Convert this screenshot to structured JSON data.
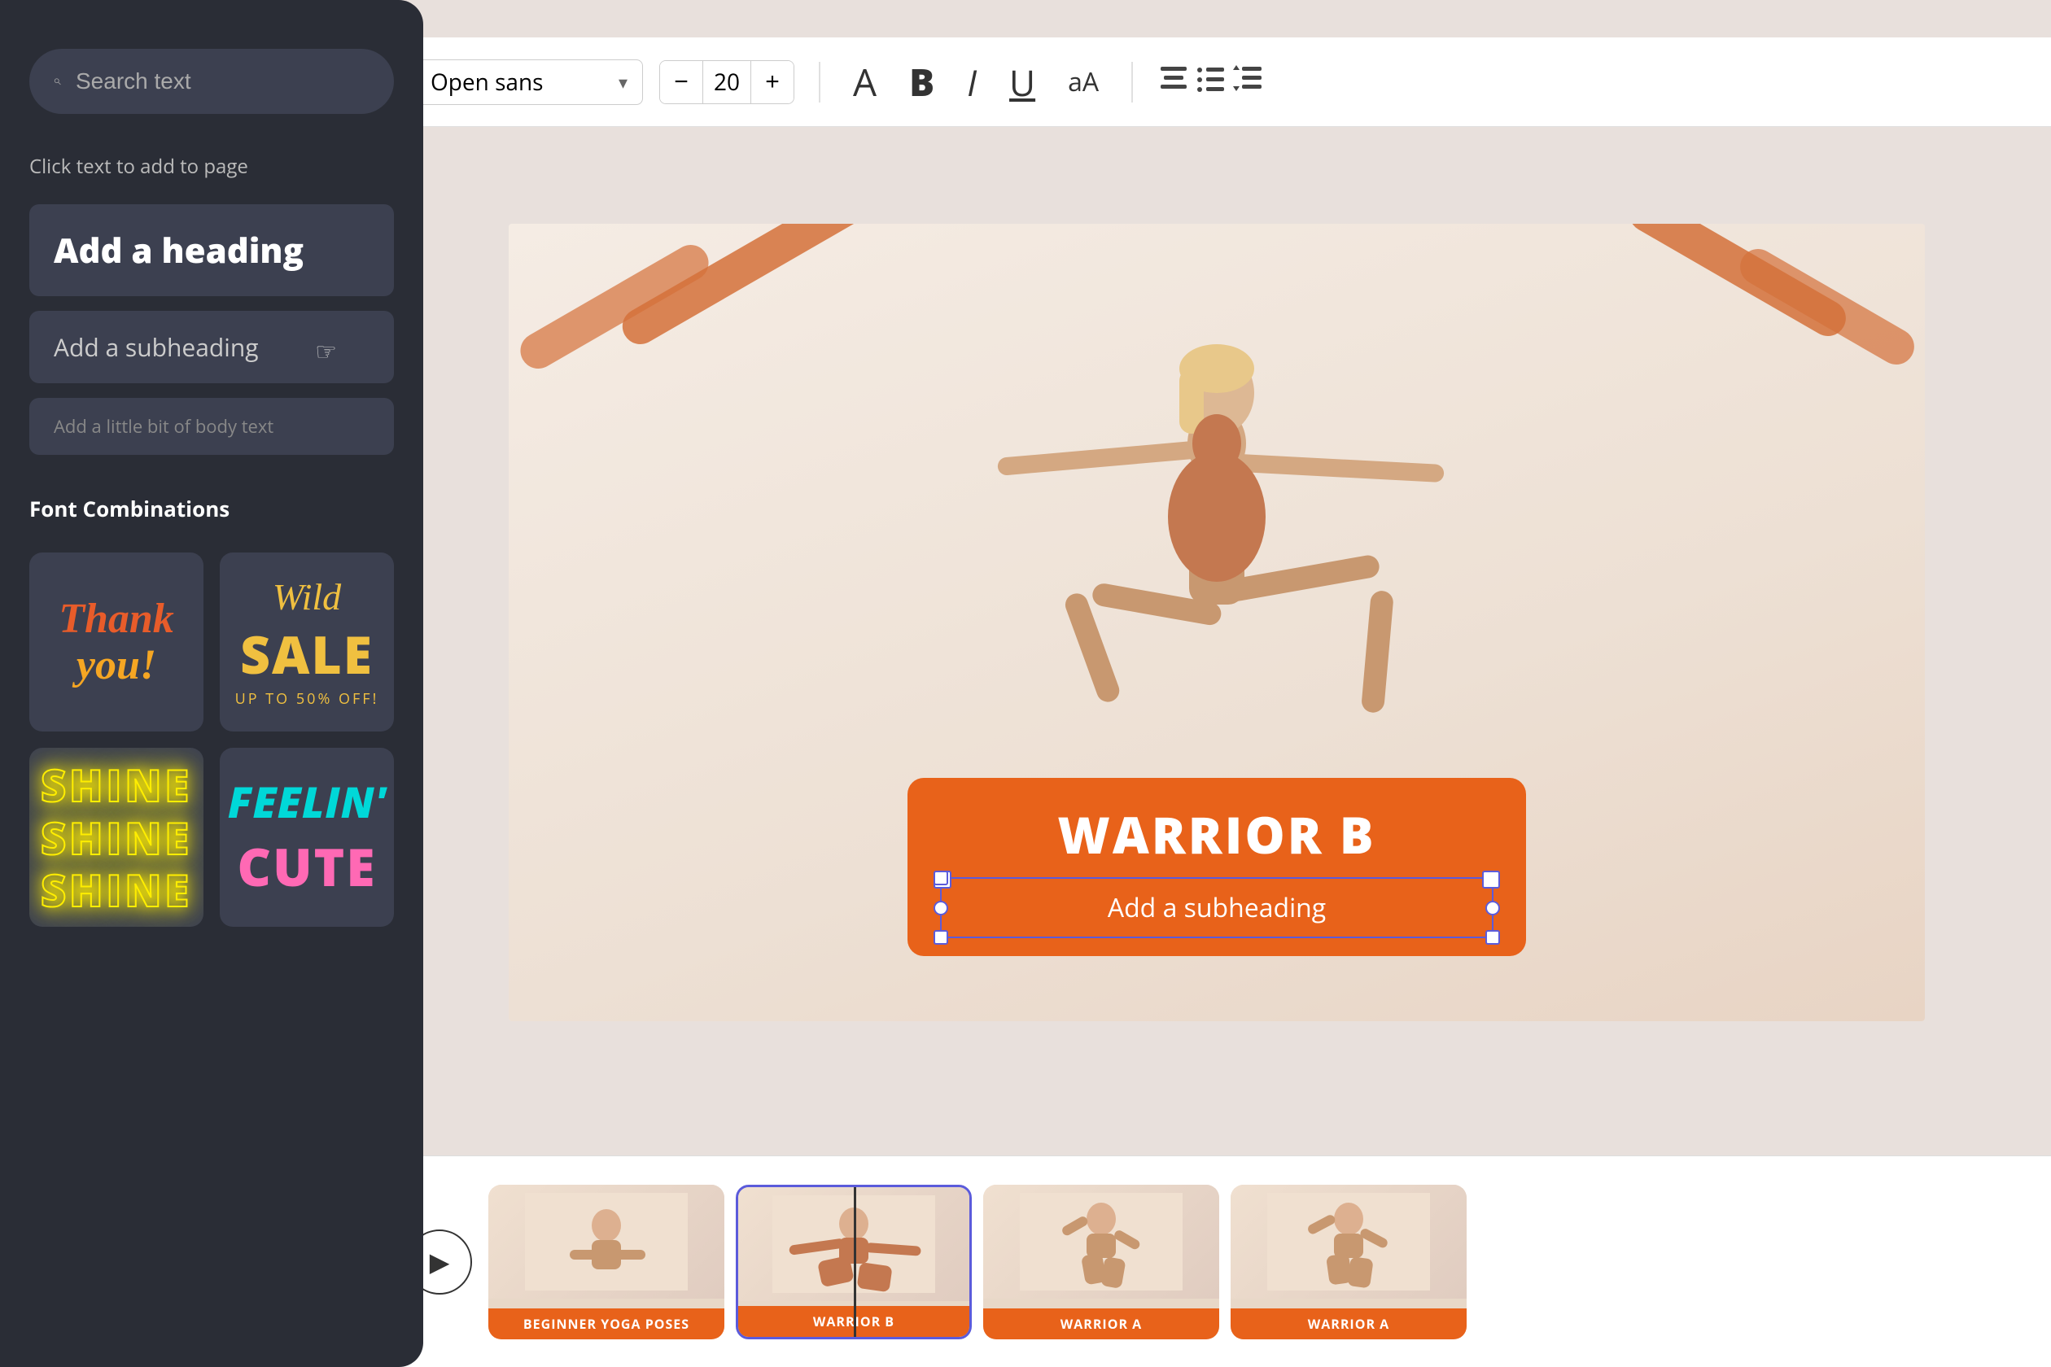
{
  "toolbar": {
    "font_name": "Open sans",
    "font_size": "20",
    "minus_label": "−",
    "plus_label": "+",
    "format_A": "A",
    "format_B": "B",
    "format_I": "I",
    "format_U": "U",
    "format_aA": "aA",
    "align_center": "≡",
    "list": "☰",
    "spacing": "↕"
  },
  "sidebar": {
    "search_placeholder": "Search text",
    "click_hint": "Click text to add to page",
    "heading_label": "Add a heading",
    "subheading_label": "Add a subheading",
    "body_label": "Add a little bit of body text",
    "section_title": "Font Combinations",
    "combo1_line1": "Thank",
    "combo1_line2": "you!",
    "combo2_wild": "Wild",
    "combo2_sale": "SALE",
    "combo2_sub": "UP TO 50% OFF!",
    "combo3_line1": "SHINE",
    "combo3_line2": "SHINE",
    "combo3_line3": "SHINE",
    "combo4_line1": "FEELIN'",
    "combo4_line2": "CUTE"
  },
  "canvas": {
    "warrior_title": "WARRIOR B",
    "subheading_text": "Add a subheading"
  },
  "timeline": {
    "play_icon": "▶",
    "card1_label": "BEGINNER YOGA POSES",
    "card2_label": "WARRIOR B",
    "card3_label": "WARRIOR A",
    "card4_label": "WARRIOR A"
  }
}
